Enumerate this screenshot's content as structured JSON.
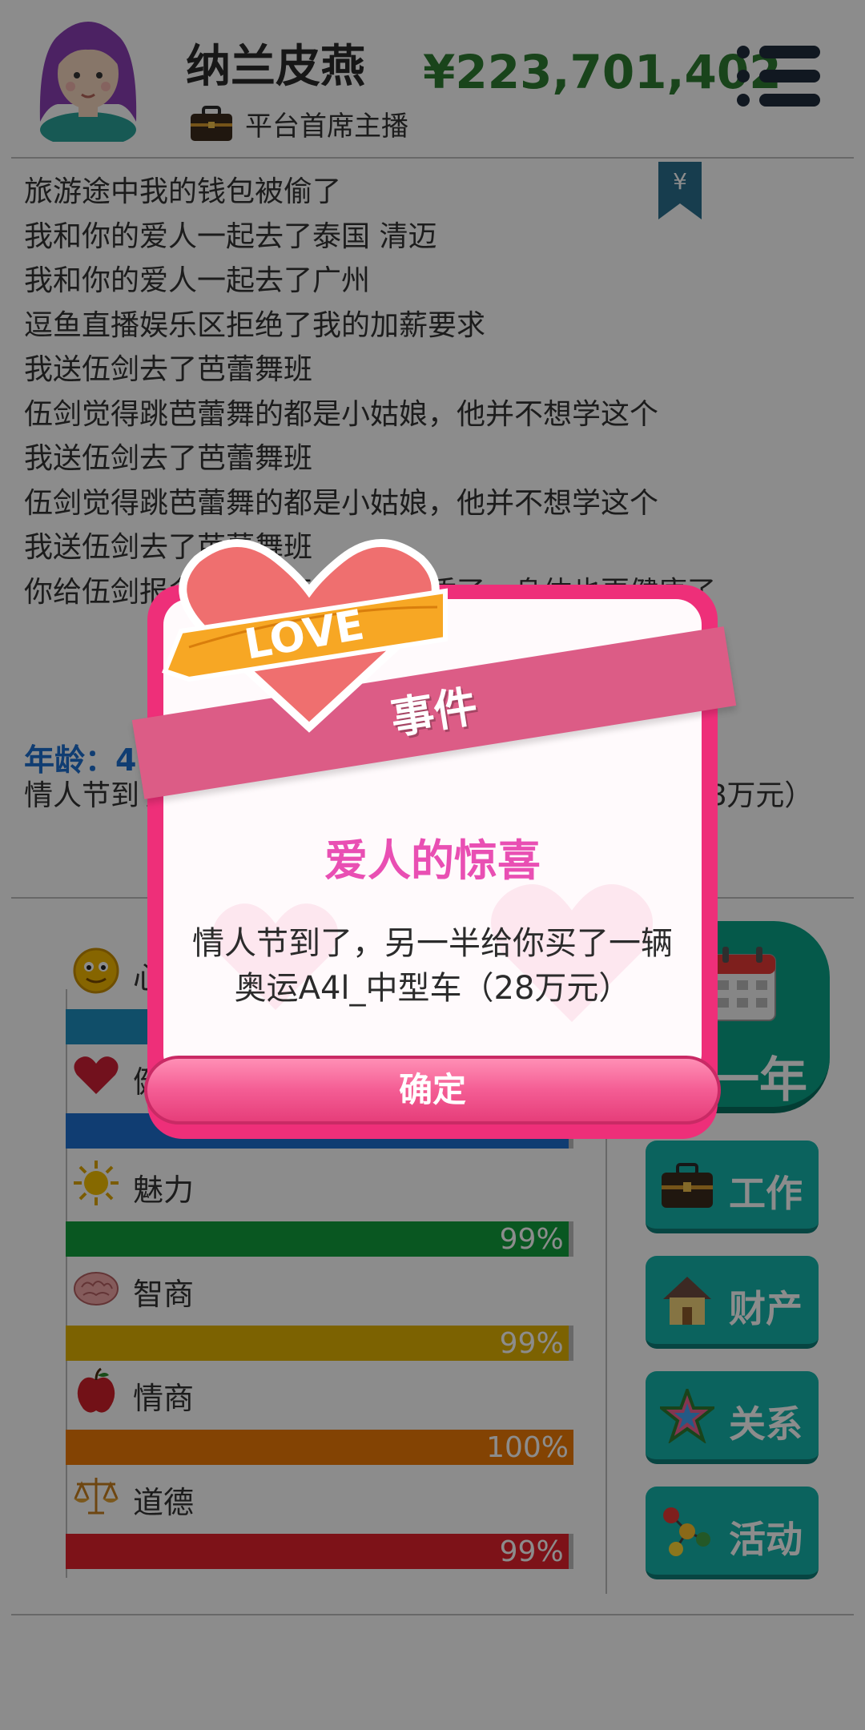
{
  "header": {
    "name": "纳兰皮燕",
    "job": "平台首席主播",
    "money": "¥223,701,402"
  },
  "log": [
    "旅游途中我的钱包被偷了",
    "我和你的爱人一起去了泰国 清迈",
    "我和你的爱人一起去了广州",
    "逗鱼直播娱乐区拒绝了我的加薪要求",
    "我送伍剑去了芭蕾舞班",
    "伍剑觉得跳芭蕾舞的都是小姑娘，他并不想学这个",
    "我送伍剑去了芭蕾舞班",
    "伍剑觉得跳芭蕾舞的都是小姑娘，他并不想学这个",
    "我送伍剑去了芭蕾舞班",
    "你给伍剑报名了……伍剑更有气质了，身体也更健康了"
  ],
  "age_label": "年龄：4",
  "event_line": "情人节到了，另一半给你买了一辆奥运A4l_中型车（28万元）",
  "stats": [
    {
      "label": "心",
      "percent": "",
      "value": 1.0,
      "color": "#1e8fbf"
    },
    {
      "label": "健",
      "percent": "",
      "value": 0.99,
      "color": "#1e6fd0"
    },
    {
      "label": "魅力",
      "percent": "99%",
      "value": 0.99,
      "color": "#119e3c"
    },
    {
      "label": "智商",
      "percent": "99%",
      "value": 0.99,
      "color": "#e2b203"
    },
    {
      "label": "情商",
      "percent": "100%",
      "value": 1.0,
      "color": "#ee7b06"
    },
    {
      "label": "道德",
      "percent": "99%",
      "value": 0.99,
      "color": "#e4222d"
    }
  ],
  "side": {
    "next_year": "一年",
    "buttons": [
      "工作",
      "财产",
      "关系",
      "活动"
    ]
  },
  "dialog": {
    "banner": "事件",
    "title": "爱人的惊喜",
    "message": "情人节到了，另一半给你买了一辆奥运A4l_中型车（28万元）",
    "confirm": "确定",
    "love_text": "LOVE"
  },
  "icons": {
    "bookmark": "yen-bookmark-icon",
    "menu": "menu-icon"
  }
}
